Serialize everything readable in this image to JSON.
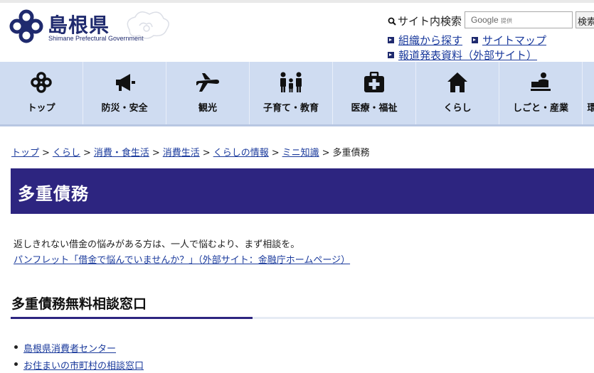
{
  "header": {
    "logo_ja": "島根県",
    "logo_en": "Shimane Prefectural Government",
    "search_label": "サイト内検索",
    "search_placeholder_brand": "Google",
    "search_placeholder_sub": "提供",
    "search_button": "検索",
    "links": [
      {
        "label": "組織から探す"
      },
      {
        "label": "サイトマップ"
      },
      {
        "label": "報道発表資料（外部サイト）"
      }
    ]
  },
  "nav": {
    "items": [
      {
        "label": "トップ",
        "icon": "home-logo-icon"
      },
      {
        "label": "防災・安全",
        "icon": "megaphone-icon"
      },
      {
        "label": "観光",
        "icon": "airplane-icon"
      },
      {
        "label": "子育て・教育",
        "icon": "family-icon"
      },
      {
        "label": "医療・福祉",
        "icon": "medical-kit-icon"
      },
      {
        "label": "くらし",
        "icon": "house-icon"
      },
      {
        "label": "しごと・産業",
        "icon": "worker-icon"
      },
      {
        "label": "環",
        "icon": "nature-icon"
      }
    ]
  },
  "breadcrumb": {
    "items": [
      "トップ",
      "くらし",
      "消費・食生活",
      "消費生活",
      "くらしの情報",
      "ミニ知識"
    ],
    "current": "多重債務",
    "separator": ">"
  },
  "page": {
    "title": "多重債務",
    "intro": "返しきれない借金の悩みがある方は、一人で悩むより、まず相談を。",
    "pamphlet_link": "パンフレット「借金で悩んでいませんか？」（外部サイト：金融庁ホームページ）",
    "section_heading": "多重債務無料相談窓口",
    "section_links": [
      "島根県消費者センター",
      "お住まいの市町村の相談窓口"
    ]
  },
  "colors": {
    "title_band": "#2d2580",
    "nav_bg": "#cfdcf1",
    "link": "#1a3a9c",
    "logo": "#1f2a6e"
  }
}
